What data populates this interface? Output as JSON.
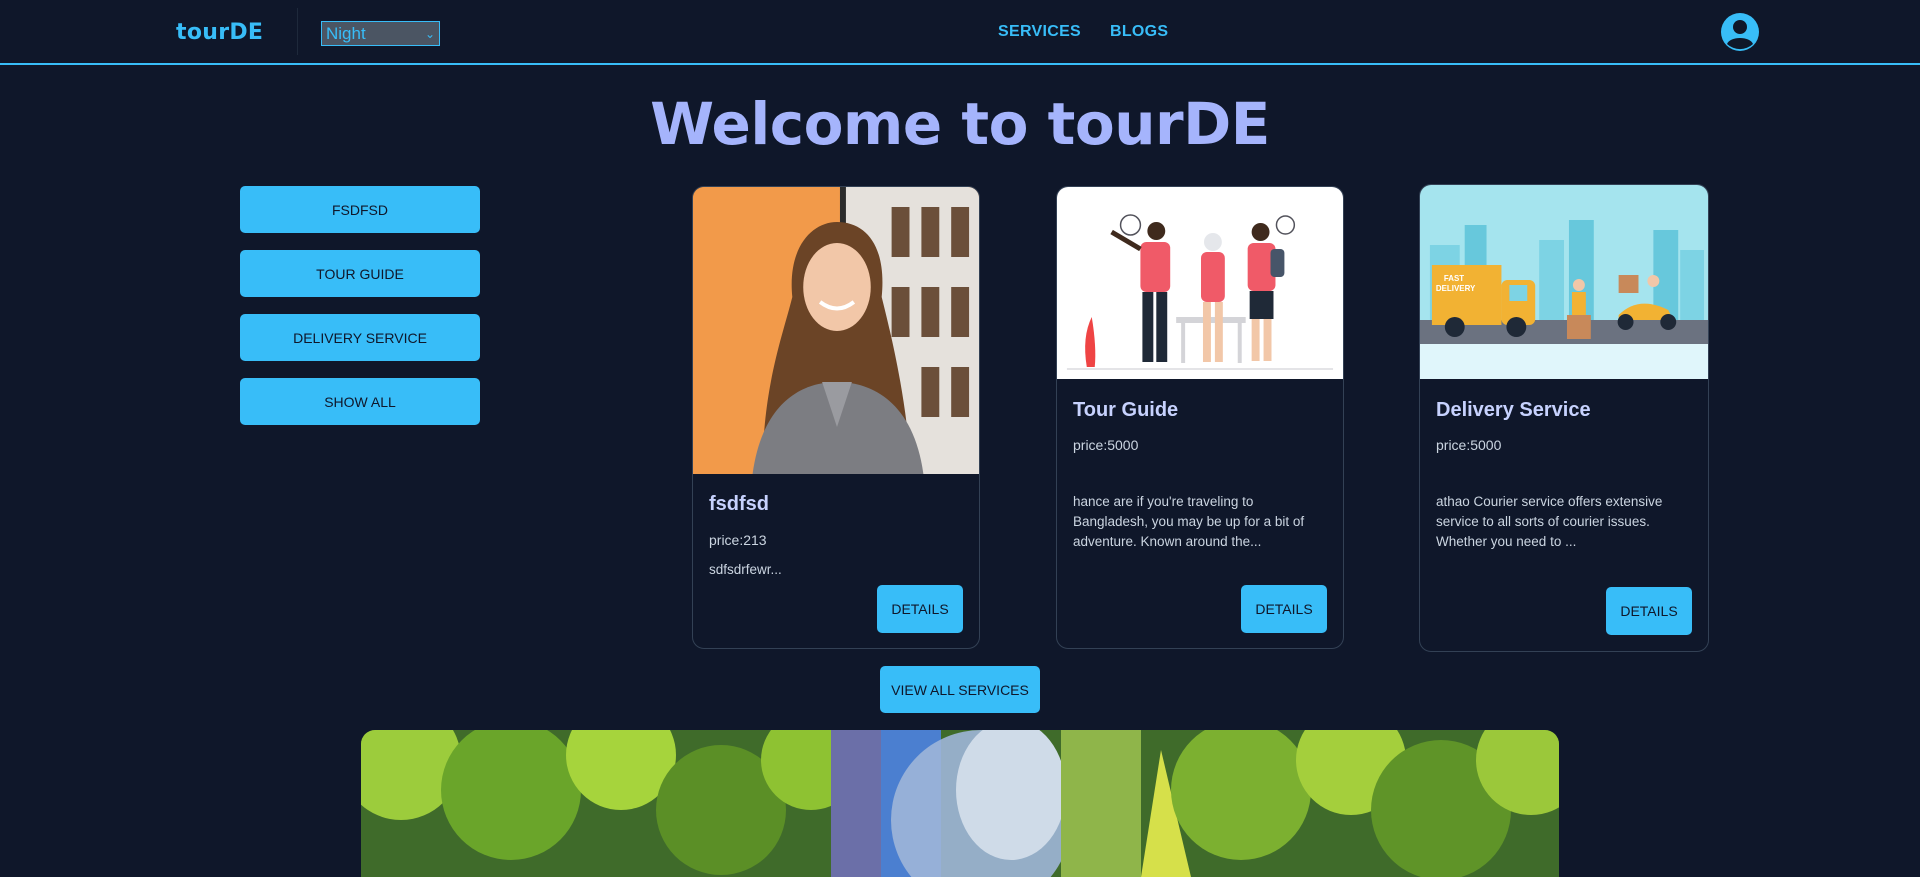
{
  "navbar": {
    "brand": "tourDE",
    "theme_select": {
      "value": "Night"
    },
    "links": [
      "SERVICES",
      "BLOGS"
    ]
  },
  "page": {
    "title": "Welcome to tourDE"
  },
  "filters": [
    "FSDFSD",
    "TOUR GUIDE",
    "DELIVERY SERVICE",
    "SHOW ALL"
  ],
  "cards": [
    {
      "title": "fsdfsd",
      "price": "price:213",
      "description": "sdfsdrfewr...",
      "button": "DETAILS"
    },
    {
      "title": "Tour Guide",
      "price": "price:5000",
      "description": "hance are if you're traveling to Bangladesh, you may be up for a bit of adventure. Known around the...",
      "button": "DETAILS"
    },
    {
      "title": "Delivery Service",
      "price": "price:5000",
      "description": "athao Courier service offers extensive service to all sorts of courier issues. Whether you need to ...",
      "button": "DETAILS"
    }
  ],
  "truck_text": {
    "line1": "FAST",
    "line2": "DELIVERY"
  },
  "view_all_button": "VIEW ALL SERVICES",
  "colors": {
    "background": "#0f172a",
    "accent": "#38bdf8",
    "title": "#a5b4fc"
  }
}
